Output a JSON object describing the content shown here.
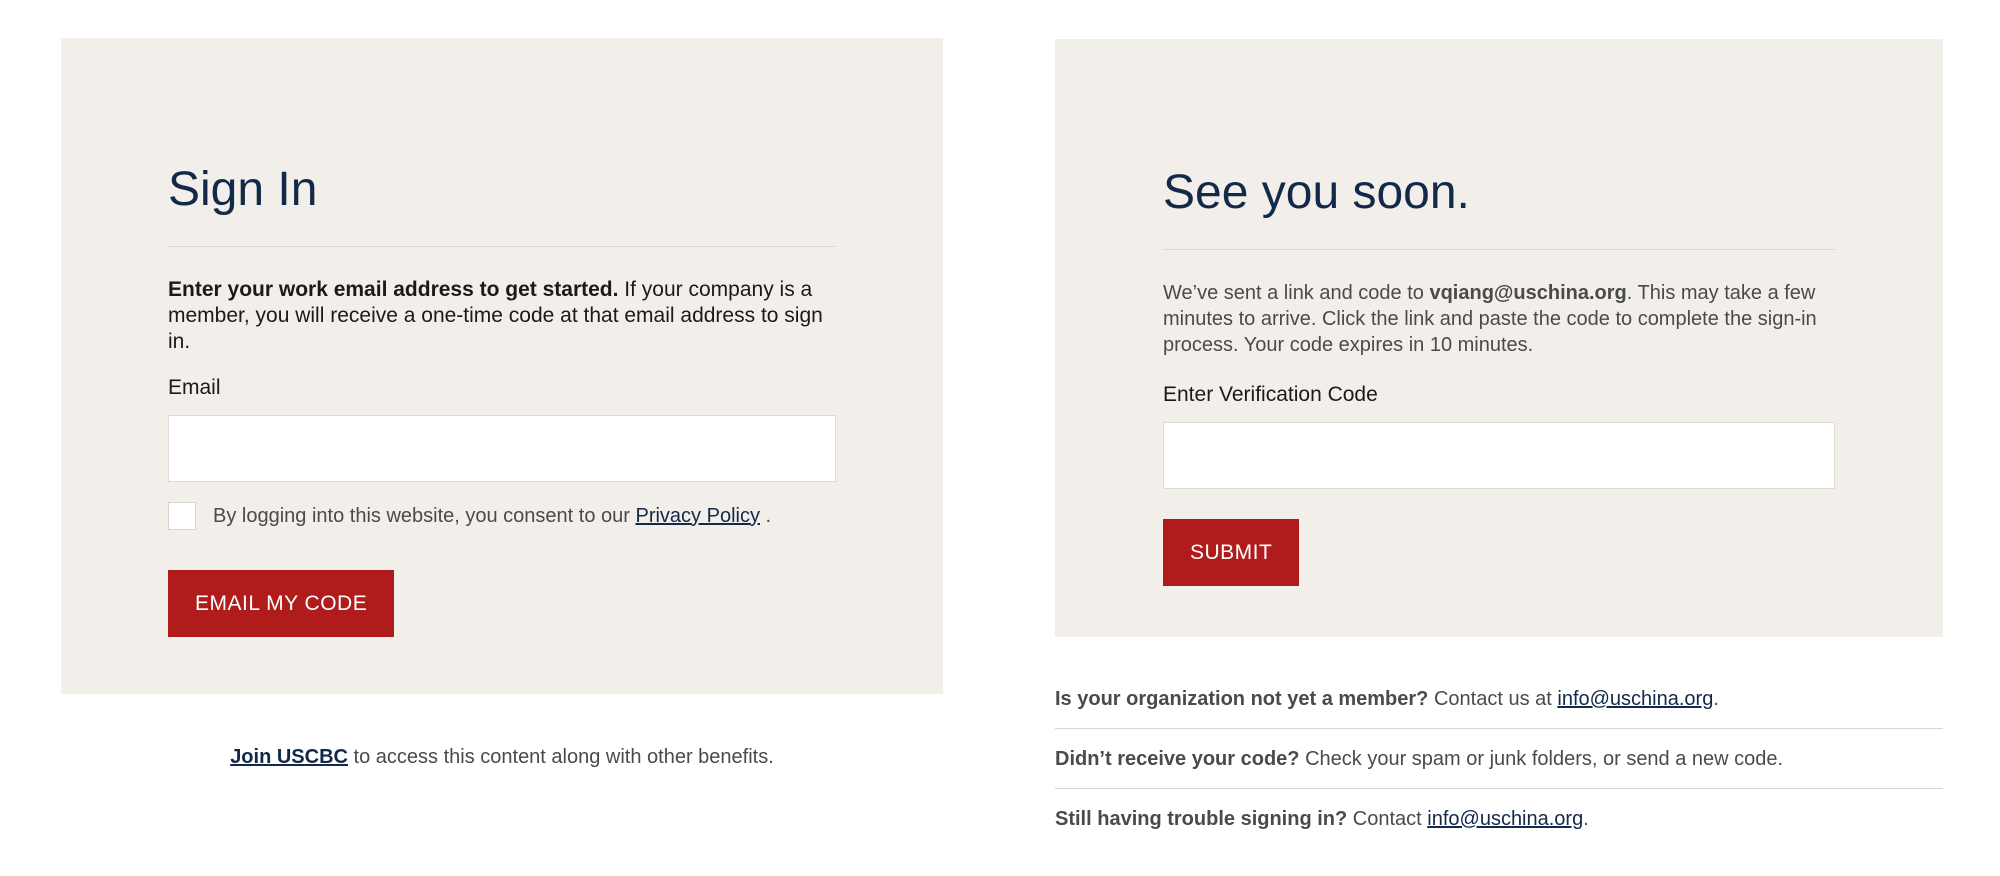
{
  "signin": {
    "title": "Sign In",
    "intro_bold": "Enter your work email address to get started.",
    "intro_rest": " If your company is a member, you will receive a one-time code at that email address to sign in.",
    "email_label": "Email",
    "email_value": "",
    "consent_text": "By logging into this website, you consent to our ",
    "privacy_link": "Privacy Policy",
    "consent_end": " .",
    "button_label": "EMAIL MY CODE"
  },
  "join": {
    "link": "Join USCBC",
    "text": " to access this content along with other benefits."
  },
  "verify": {
    "title": "See you soon.",
    "msg_start": "We’ve sent a link and code to ",
    "email": "vqiang@uschina.org",
    "msg_end": ". This may take a few minutes to arrive. Click the link and paste the code to complete the sign-in process. Your code expires in 10 minutes.",
    "code_label": "Enter Verification Code",
    "code_value": "",
    "button_label": "SUBMIT"
  },
  "faq": [
    {
      "q": "Is your organization not yet a member?",
      "a": " Contact us at ",
      "link": "info@uschina.org",
      "end": "."
    },
    {
      "q": "Didn’t receive your code?",
      "a": " Check your spam or junk folders, or send a new code.",
      "link": "",
      "end": ""
    },
    {
      "q": "Still having trouble signing in?",
      "a": " Contact ",
      "link": "info@uschina.org",
      "end": "."
    }
  ],
  "colors": {
    "panel_bg": "#f2efea",
    "heading": "#12294a",
    "button": "#b01c1c"
  }
}
